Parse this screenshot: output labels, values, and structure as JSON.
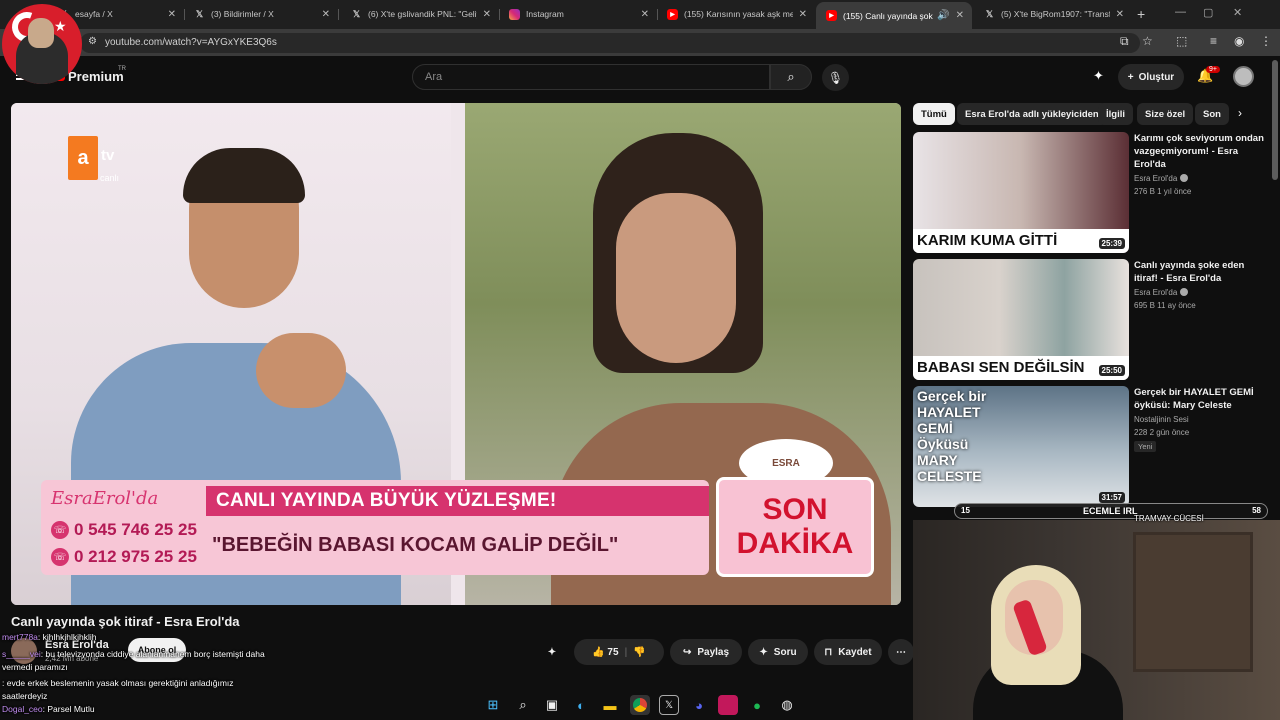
{
  "browser": {
    "tabs": [
      {
        "title": "esayfa / X",
        "icon": "x-icon"
      },
      {
        "title": "(3) Bildirimler / X",
        "icon": "x-icon"
      },
      {
        "title": "(6) X'te gslivandik PNL: \"Geliy",
        "icon": "x-icon"
      },
      {
        "title": "Instagram",
        "icon": "instagram-icon"
      },
      {
        "title": "(155) Karısının yasak aşk mesa",
        "icon": "youtube-icon"
      },
      {
        "title": "(155) Canlı yayında şok itira",
        "icon": "youtube-icon",
        "active": true
      },
      {
        "title": "(5) X'te BigRom1907: \"Transfer",
        "icon": "x-icon"
      }
    ],
    "url": "youtube.com/watch?v=AYGxYKE3Q6s"
  },
  "youtube": {
    "brand": "Premium",
    "brand_sup": "TR",
    "search_placeholder": "Ara",
    "create_label": "Oluştur",
    "notif_count": "9+"
  },
  "video": {
    "overlay": {
      "channel_logo": "a",
      "channel_tv": "tv",
      "channel_live": "canlı",
      "brand_script": "EsraErol'da",
      "headline": "CANLI YAYINDA BÜYÜK YÜZLEŞME!",
      "subline": "\"BEBEĞİN BABASI KOCAM GALİP DEĞİL\"",
      "phone1": "0 545 746 25 25",
      "phone2": "0 212 975 25 25",
      "breaking_line1": "SON",
      "breaking_line2": "DAKİKA",
      "namecard": "ESRA"
    },
    "title": "Canlı yayında şok itiraf - Esra Erol'da",
    "channel": "Esra Erol'da",
    "subs": "2,42 Mn abone",
    "subscribe_label": "Abone ol",
    "likes": "75",
    "share_label": "Paylaş",
    "ask_label": "Soru",
    "save_label": "Kaydet"
  },
  "chat": [
    {
      "user": "mert778a",
      "text": ": kjhlhkjhlkjhklih"
    },
    {
      "user": "s_____vei",
      "text": ": bu televizyonda ciddiye alanlanmanem borç istemişti daha"
    },
    {
      "user": "",
      "text": "vermedi paramızı"
    },
    {
      "user": "",
      "text": ": evde erkek beslemenin yasak olması gerektiğini anladığımız"
    },
    {
      "user": "",
      "text": "saatlerdeyiz"
    },
    {
      "user": "Dogal_ceo",
      "text": ": Parsel Mutlu"
    }
  ],
  "sidebar": {
    "chips": [
      "Tümü",
      "Esra Erol'da adlı yükleyiciden",
      "İlgili",
      "Size özel",
      "Son"
    ],
    "recs": [
      {
        "title": "Karımı çok seviyorum ondan vazgeçmiyorum! - Esra Erol'da",
        "channel": "Esra Erol'da",
        "meta": "276 B  1 yıl önce",
        "duration": "25:39",
        "thumb_caption": "KARIM KUMA GİTTİ"
      },
      {
        "title": "Canlı yayında şoke eden itiraf! - Esra Erol'da",
        "channel": "Esra Erol'da",
        "meta": "695 B  11 ay önce",
        "duration": "25:50",
        "thumb_caption": "BABASI SEN DEĞİLSİN"
      },
      {
        "title": "Gerçek bir HAYALET GEMİ öyküsü: Mary Celeste",
        "channel": "Nostaljinin Sesi",
        "meta": "228  2 gün önce",
        "duration": "31:57",
        "badge": "Yeni",
        "thumb_caption": "Gerçek bir HAYALET GEMİ Öyküsü MARY CELESTE"
      }
    ]
  },
  "stream_banner": {
    "left": "15",
    "middle": "ECEMLE IRL",
    "right": "58",
    "sub": "TRAMVAY CÜCESİ"
  },
  "colors": {
    "youtube_red": "#ff0000",
    "atv_orange": "#f47a20",
    "show_pink": "#d6336e",
    "breaking_red": "#d2122e"
  }
}
